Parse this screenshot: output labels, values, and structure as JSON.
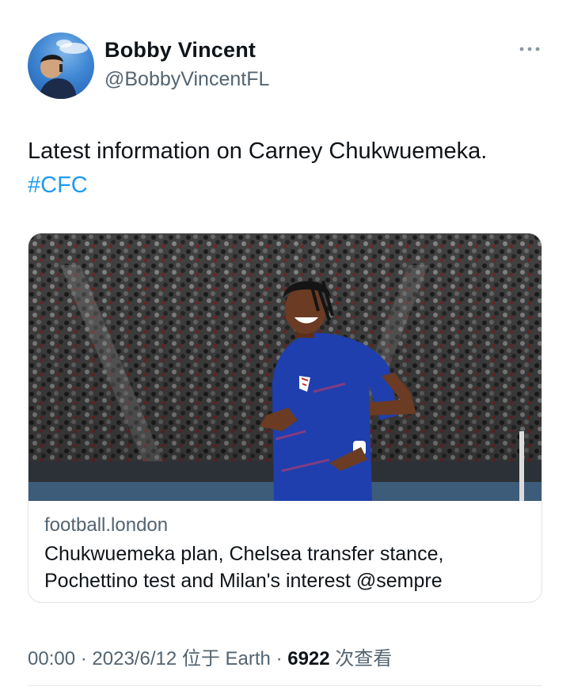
{
  "author": {
    "name": "Bobby Vincent",
    "handle": "@BobbyVincentFL"
  },
  "tweet": {
    "text": "Latest information on Carney Chukwuemeka.",
    "hashtag": "#CFC"
  },
  "card": {
    "domain": "football.london",
    "title": "Chukwuemeka plan, Chelsea transfer stance, Pochettino test and Milan's interest @sempre"
  },
  "meta": {
    "time": "00:00",
    "separator": "·",
    "date": "2023/6/12",
    "location": "位于 Earth",
    "views_count": "6922",
    "views_label": "次查看"
  },
  "icons": {
    "more": "more-horizontal-icon"
  },
  "colors": {
    "accent": "#1d9bf0",
    "secondary_text": "#536471",
    "primary_text": "#0f1419",
    "kit": "#1f3fae"
  }
}
